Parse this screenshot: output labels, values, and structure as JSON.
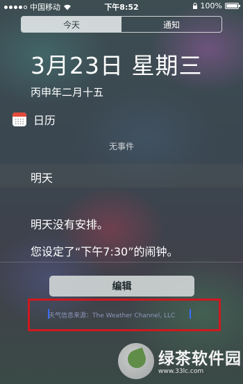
{
  "status_bar": {
    "carrier": "中国移动",
    "time": "下午8:52",
    "battery": "100%",
    "battery_level": 1.0
  },
  "tabs": [
    {
      "label": "今天",
      "active": true
    },
    {
      "label": "通知",
      "active": false
    }
  ],
  "today": {
    "date": "3月23日 星期三",
    "lunar_date": "丙申年二月十五"
  },
  "calendar": {
    "title": "日历",
    "icon": "calendar-icon",
    "empty_text": "无事件"
  },
  "tomorrow": {
    "title": "明天",
    "no_plans": "明天没有安排。",
    "alarm_text": "您设定了“下午7:30”的闹钟。"
  },
  "edit_label": "编辑",
  "weather_source": "天气信息来源：The Weather Channel, LLC",
  "highlight_color": "#d0181e",
  "watermark": {
    "name": "绿茶软件园",
    "sub": "www.33lc.com"
  }
}
